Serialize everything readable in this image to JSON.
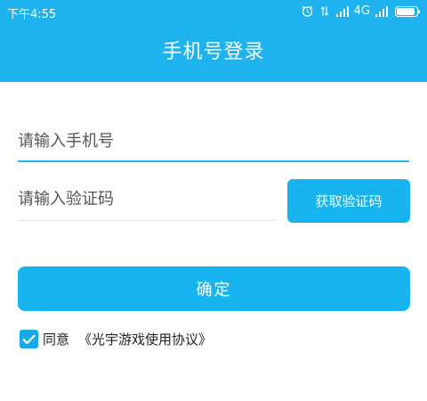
{
  "status_bar": {
    "time": "下午4:55",
    "network": "4G",
    "icons": [
      "alarm-icon",
      "data-transfer-icon",
      "signal-icon",
      "signal-icon",
      "battery-icon"
    ]
  },
  "header": {
    "title": "手机号登录",
    "background_color": "#1eb3ee"
  },
  "form": {
    "phone_placeholder": "请输入手机号",
    "code_placeholder": "请输入验证码",
    "get_code_label": "获取验证码",
    "confirm_label": "确定"
  },
  "agreement": {
    "checked": true,
    "prefix": "同意",
    "link_text": "《光宇游戏使用协议》"
  },
  "accent_color": "#18b4f0"
}
